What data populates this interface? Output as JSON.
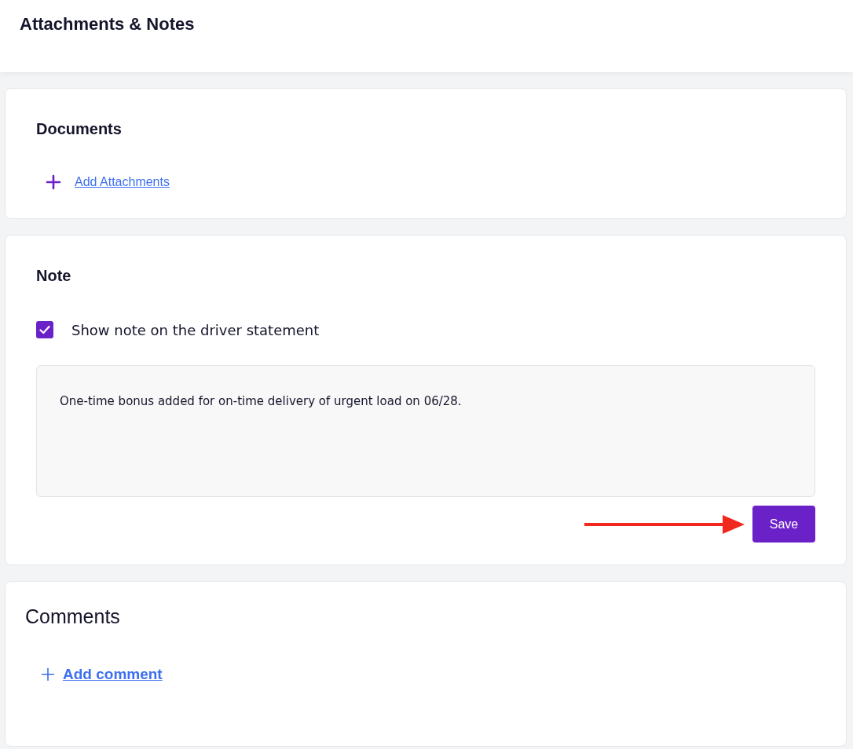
{
  "header": {
    "title": "Attachments & Notes"
  },
  "documents": {
    "title": "Documents",
    "add_link": "Add Attachments"
  },
  "note": {
    "title": "Note",
    "checkbox": {
      "label": "Show note on the driver statement",
      "checked": true
    },
    "text": "One-time bonus added for on-time delivery of urgent load on 06/28.",
    "save_button": "Save"
  },
  "comments": {
    "title": "Comments",
    "add_link": "Add comment"
  }
}
